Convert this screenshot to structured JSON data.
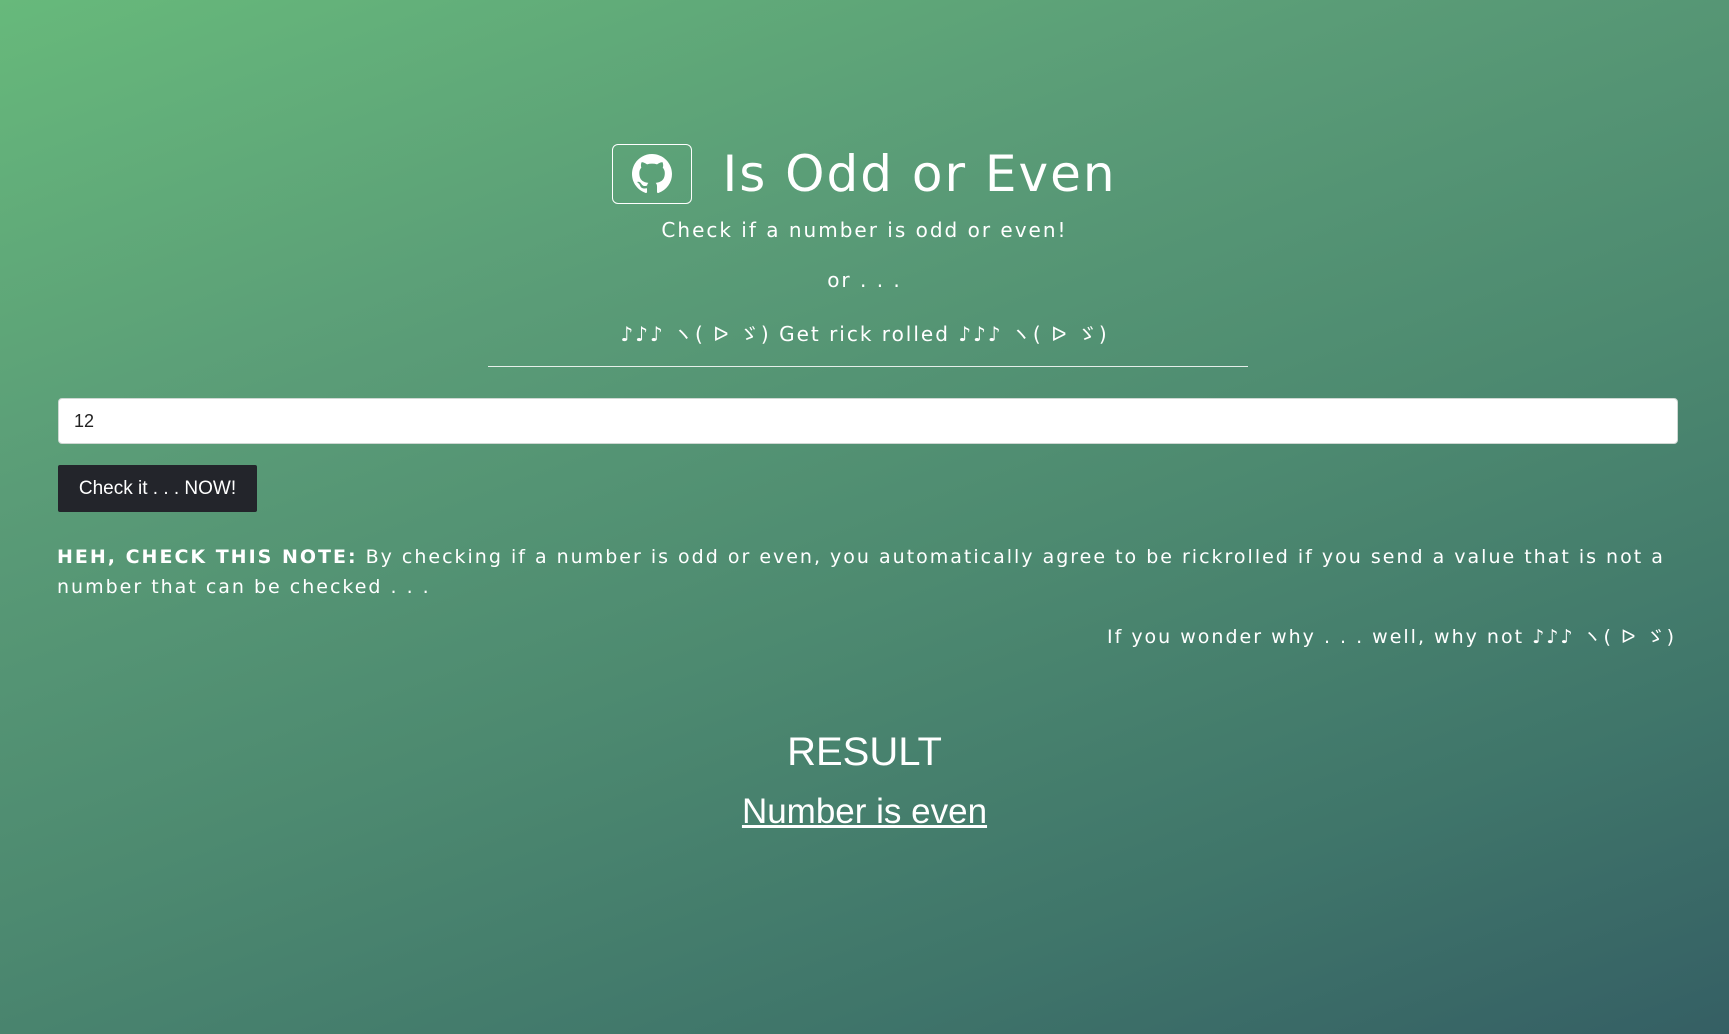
{
  "header": {
    "title": "Is Odd or Even",
    "github_icon": "github-icon"
  },
  "intro": {
    "subtitle": "Check if a number is odd or even!",
    "or_text": "or . . .",
    "rick_text": "♪♪♪ ヽ( ᐅ ゞ) Get rick rolled ♪♪♪ ヽ( ᐅ ゞ)"
  },
  "form": {
    "input_value": "12",
    "button_label": "Check it . . . NOW!"
  },
  "note": {
    "label": "HEH, CHECK THIS NOTE:",
    "text": " By checking if a number is odd or even, you automatically agree to be rickrolled if you send a value that is not a number that can be checked . . .",
    "why_text": "If you wonder why . . . well, why not ♪♪♪ ヽ( ᐅ ゞ)"
  },
  "result": {
    "heading": "RESULT",
    "text": "Number is even"
  },
  "colors": {
    "gradient_start": "#67b97b",
    "gradient_end": "#355f64",
    "button_bg": "#23252b"
  }
}
